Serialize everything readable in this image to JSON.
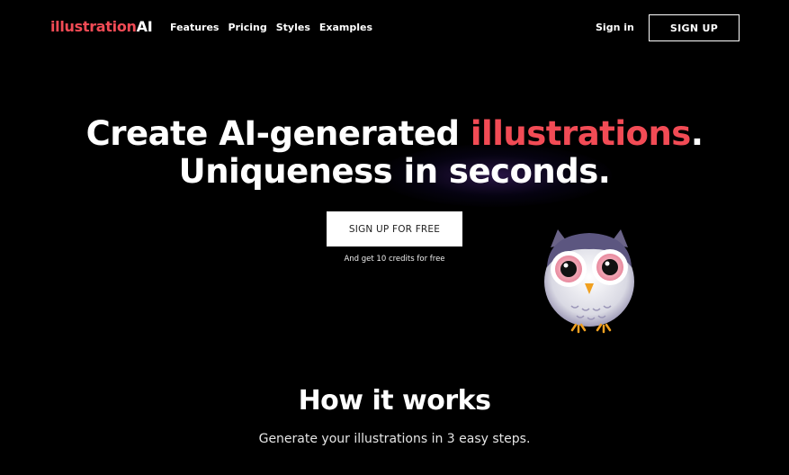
{
  "nav": {
    "logo_part1": "illustration",
    "logo_part2": "AI",
    "links": [
      "Features",
      "Pricing",
      "Styles",
      "Examples"
    ],
    "sign_in": "Sign in",
    "sign_up": "SIGN UP"
  },
  "hero": {
    "line1_prefix": "Create AI-generated ",
    "line1_accent": "illustrations",
    "line1_suffix": ".",
    "line2": "Uniqueness in seconds.",
    "cta": "SIGN UP FOR FREE",
    "cta_note": "And get 10 credits for free"
  },
  "how": {
    "title": "How it works",
    "subtitle": "Generate your illustrations in 3 easy steps."
  },
  "colors": {
    "accent": "#f24b55",
    "background": "#000000"
  },
  "icons": {
    "mascot": "owl-illustration"
  }
}
